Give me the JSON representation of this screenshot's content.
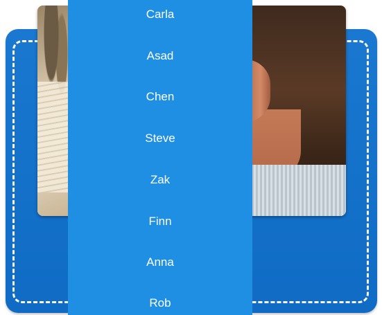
{
  "colors": {
    "wallet_blue": "#1a78d0",
    "list_blue": "#1e8fe2",
    "stitch": "#ffffff",
    "text": "#ffffff"
  },
  "name_list": {
    "items": [
      {
        "label": "Carla"
      },
      {
        "label": "Asad"
      },
      {
        "label": "Chen"
      },
      {
        "label": "Steve"
      },
      {
        "label": "Zak"
      },
      {
        "label": "Finn"
      },
      {
        "label": "Anna"
      },
      {
        "label": "Rob"
      }
    ]
  }
}
